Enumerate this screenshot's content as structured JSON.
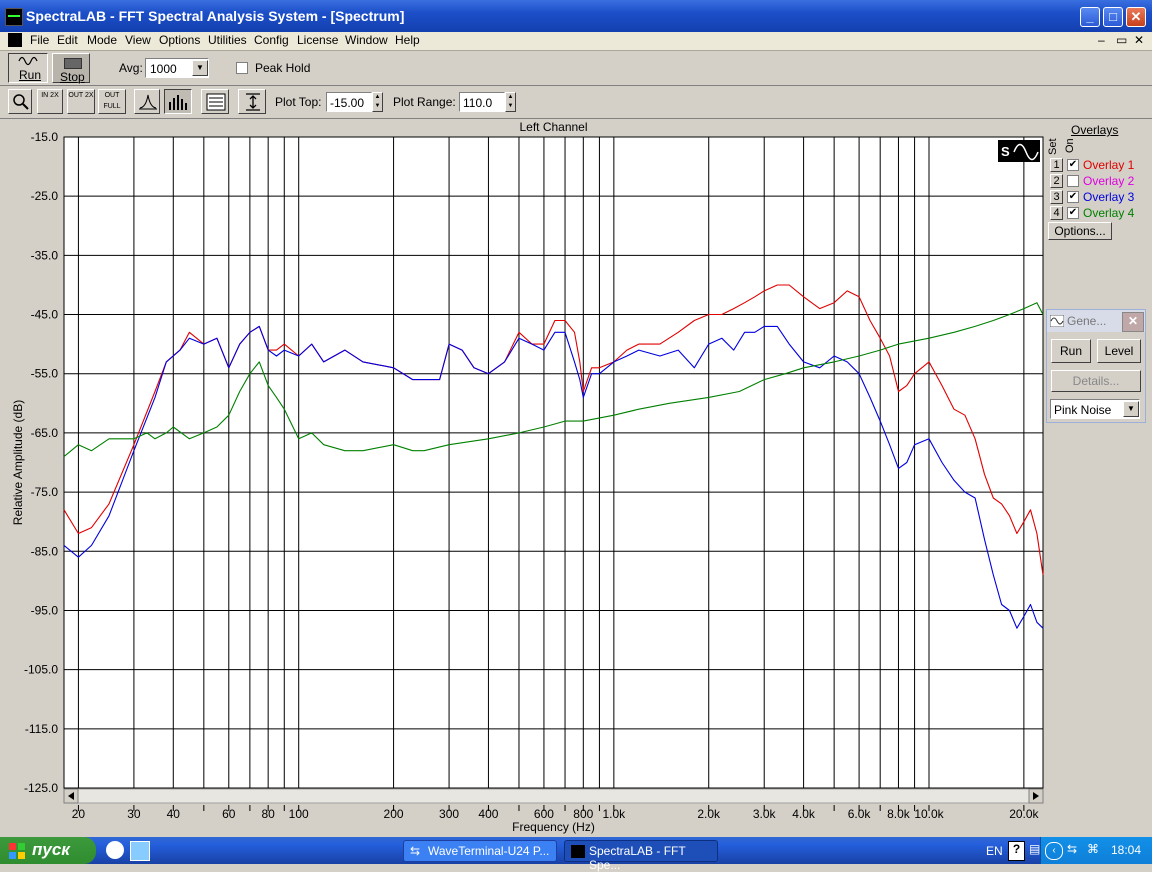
{
  "window": {
    "title": "SpectraLAB - FFT Spectral Analysis System - [Spectrum]"
  },
  "menu": [
    "File",
    "Edit",
    "Mode",
    "View",
    "Options",
    "Utilities",
    "Config",
    "License",
    "Window",
    "Help"
  ],
  "toolbar1": {
    "run_label": "Run",
    "stop_label": "Stop",
    "avg_label": "Avg:",
    "avg_value": "1000",
    "peak_hold_label": "Peak Hold"
  },
  "toolbar2": {
    "plot_top_label": "Plot Top:",
    "plot_top_value": "-15.00",
    "plot_range_label": "Plot Range:",
    "plot_range_value": "110.0",
    "zoom_in_label": "IN 2X",
    "zoom_out_label": "OUT 2X",
    "zoom_full_label": "OUT FULL"
  },
  "overlays": {
    "title": "Overlays",
    "set_label": "Set",
    "on_label": "On",
    "options_label": "Options...",
    "items": [
      {
        "num": "1",
        "label": "Overlay 1",
        "checked": true,
        "color": "#e00000"
      },
      {
        "num": "2",
        "label": "Overlay 2",
        "checked": false,
        "color": "#e000e0"
      },
      {
        "num": "3",
        "label": "Overlay 3",
        "checked": true,
        "color": "#0000e0"
      },
      {
        "num": "4",
        "label": "Overlay 4",
        "checked": true,
        "color": "#008000"
      }
    ]
  },
  "generator": {
    "title": "Gene...",
    "run_label": "Run",
    "level_label": "Level",
    "details_label": "Details...",
    "signal": "Pink Noise"
  },
  "taskbar": {
    "start_label": "пуск",
    "tasks": [
      "WaveTerminal-U24 P...",
      "SpectraLAB - FFT Spe..."
    ],
    "lang": "EN",
    "clock": "18:04"
  },
  "chart_data": {
    "type": "line",
    "title": "Left Channel",
    "xlabel": "Frequency (Hz)",
    "ylabel": "Relative Amplitude (dB)",
    "xscale": "log",
    "xlim": [
      18,
      23000
    ],
    "ylim": [
      -125,
      -15
    ],
    "grid": true,
    "yticks": [
      "-15.0",
      "-25.0",
      "-35.0",
      "-45.0",
      "-55.0",
      "-65.0",
      "-75.0",
      "-85.0",
      "-95.0",
      "-105.0",
      "-115.0",
      "-125.0"
    ],
    "xticks": [
      {
        "v": 20,
        "t": "20"
      },
      {
        "v": 30,
        "t": "30"
      },
      {
        "v": 40,
        "t": "40"
      },
      {
        "v": 60,
        "t": "60"
      },
      {
        "v": 80,
        "t": "80"
      },
      {
        "v": 100,
        "t": "100"
      },
      {
        "v": 200,
        "t": "200"
      },
      {
        "v": 300,
        "t": "300"
      },
      {
        "v": 400,
        "t": "400"
      },
      {
        "v": 600,
        "t": "600"
      },
      {
        "v": 800,
        "t": "800"
      },
      {
        "v": 1000,
        "t": "1.0k"
      },
      {
        "v": 2000,
        "t": "2.0k"
      },
      {
        "v": 3000,
        "t": "3.0k"
      },
      {
        "v": 4000,
        "t": "4.0k"
      },
      {
        "v": 6000,
        "t": "6.0k"
      },
      {
        "v": 8000,
        "t": "8.0k"
      },
      {
        "v": 10000,
        "t": "10.0k"
      },
      {
        "v": 20000,
        "t": "20.0k"
      }
    ],
    "series": [
      {
        "name": "Overlay 1",
        "color": "#e00000",
        "points": [
          [
            18,
            -78
          ],
          [
            20,
            -82
          ],
          [
            22,
            -81
          ],
          [
            25,
            -77
          ],
          [
            30,
            -67
          ],
          [
            35,
            -58
          ],
          [
            38,
            -53
          ],
          [
            42,
            -51
          ],
          [
            45,
            -48
          ],
          [
            50,
            -50
          ],
          [
            55,
            -49
          ],
          [
            60,
            -54
          ],
          [
            65,
            -50
          ],
          [
            70,
            -48
          ],
          [
            75,
            -47
          ],
          [
            80,
            -51
          ],
          [
            85,
            -51
          ],
          [
            90,
            -50
          ],
          [
            100,
            -52
          ],
          [
            110,
            -50
          ],
          [
            120,
            -53
          ],
          [
            140,
            -51
          ],
          [
            160,
            -53
          ],
          [
            200,
            -54
          ],
          [
            230,
            -56
          ],
          [
            250,
            -56
          ],
          [
            280,
            -56
          ],
          [
            300,
            -50
          ],
          [
            330,
            -51
          ],
          [
            360,
            -54
          ],
          [
            400,
            -55
          ],
          [
            450,
            -53
          ],
          [
            500,
            -48
          ],
          [
            550,
            -50
          ],
          [
            600,
            -50
          ],
          [
            650,
            -46
          ],
          [
            700,
            -46
          ],
          [
            750,
            -48
          ],
          [
            780,
            -53
          ],
          [
            800,
            -58
          ],
          [
            850,
            -54
          ],
          [
            900,
            -54
          ],
          [
            1000,
            -53
          ],
          [
            1100,
            -51
          ],
          [
            1200,
            -50
          ],
          [
            1400,
            -50
          ],
          [
            1600,
            -48
          ],
          [
            1800,
            -46
          ],
          [
            2000,
            -45
          ],
          [
            2200,
            -45
          ],
          [
            2400,
            -44
          ],
          [
            2600,
            -43
          ],
          [
            2800,
            -42
          ],
          [
            3000,
            -41
          ],
          [
            3300,
            -40
          ],
          [
            3600,
            -40
          ],
          [
            4000,
            -42
          ],
          [
            4500,
            -44
          ],
          [
            5000,
            -43
          ],
          [
            5500,
            -41
          ],
          [
            6000,
            -42
          ],
          [
            6500,
            -46
          ],
          [
            7000,
            -49
          ],
          [
            7500,
            -52
          ],
          [
            8000,
            -58
          ],
          [
            8500,
            -57
          ],
          [
            9000,
            -55
          ],
          [
            10000,
            -53
          ],
          [
            11000,
            -57
          ],
          [
            12000,
            -61
          ],
          [
            13000,
            -62
          ],
          [
            14000,
            -66
          ],
          [
            15000,
            -72
          ],
          [
            16000,
            -76
          ],
          [
            17000,
            -77
          ],
          [
            18000,
            -79
          ],
          [
            19000,
            -82
          ],
          [
            20000,
            -80
          ],
          [
            21000,
            -78
          ],
          [
            22000,
            -82
          ],
          [
            23000,
            -89
          ]
        ]
      },
      {
        "name": "Overlay 3",
        "color": "#0000e0",
        "points": [
          [
            18,
            -84
          ],
          [
            20,
            -86
          ],
          [
            22,
            -84
          ],
          [
            25,
            -79
          ],
          [
            30,
            -68
          ],
          [
            35,
            -59
          ],
          [
            38,
            -53
          ],
          [
            42,
            -51
          ],
          [
            45,
            -49
          ],
          [
            50,
            -50
          ],
          [
            55,
            -49
          ],
          [
            60,
            -54
          ],
          [
            65,
            -50
          ],
          [
            70,
            -48
          ],
          [
            75,
            -47
          ],
          [
            80,
            -51
          ],
          [
            85,
            -52
          ],
          [
            90,
            -51
          ],
          [
            100,
            -52
          ],
          [
            110,
            -50
          ],
          [
            120,
            -53
          ],
          [
            140,
            -51
          ],
          [
            160,
            -53
          ],
          [
            200,
            -54
          ],
          [
            230,
            -56
          ],
          [
            250,
            -56
          ],
          [
            280,
            -56
          ],
          [
            300,
            -50
          ],
          [
            330,
            -51
          ],
          [
            360,
            -54
          ],
          [
            400,
            -55
          ],
          [
            450,
            -53
          ],
          [
            500,
            -49
          ],
          [
            550,
            -50
          ],
          [
            600,
            -51
          ],
          [
            650,
            -48
          ],
          [
            700,
            -48
          ],
          [
            750,
            -53
          ],
          [
            780,
            -56
          ],
          [
            800,
            -59
          ],
          [
            850,
            -55
          ],
          [
            900,
            -55
          ],
          [
            1000,
            -53
          ],
          [
            1100,
            -52
          ],
          [
            1200,
            -51
          ],
          [
            1400,
            -52
          ],
          [
            1600,
            -51
          ],
          [
            1800,
            -54
          ],
          [
            2000,
            -50
          ],
          [
            2200,
            -49
          ],
          [
            2400,
            -51
          ],
          [
            2600,
            -48
          ],
          [
            2800,
            -48
          ],
          [
            3000,
            -47
          ],
          [
            3300,
            -47
          ],
          [
            3600,
            -50
          ],
          [
            4000,
            -53
          ],
          [
            4500,
            -54
          ],
          [
            5000,
            -52
          ],
          [
            5500,
            -53
          ],
          [
            6000,
            -55
          ],
          [
            6500,
            -59
          ],
          [
            7000,
            -63
          ],
          [
            7500,
            -67
          ],
          [
            8000,
            -71
          ],
          [
            8500,
            -70
          ],
          [
            9000,
            -67
          ],
          [
            10000,
            -66
          ],
          [
            11000,
            -70
          ],
          [
            12000,
            -73
          ],
          [
            13000,
            -75
          ],
          [
            14000,
            -76
          ],
          [
            15000,
            -83
          ],
          [
            16000,
            -89
          ],
          [
            17000,
            -94
          ],
          [
            18000,
            -95
          ],
          [
            19000,
            -98
          ],
          [
            20000,
            -96
          ],
          [
            21000,
            -94
          ],
          [
            22000,
            -97
          ],
          [
            23000,
            -98
          ]
        ]
      },
      {
        "name": "Overlay 4",
        "color": "#008000",
        "points": [
          [
            18,
            -69
          ],
          [
            20,
            -67
          ],
          [
            22,
            -68
          ],
          [
            25,
            -66
          ],
          [
            28,
            -66
          ],
          [
            30,
            -66
          ],
          [
            33,
            -65
          ],
          [
            35,
            -66
          ],
          [
            38,
            -65
          ],
          [
            40,
            -64
          ],
          [
            45,
            -66
          ],
          [
            50,
            -65
          ],
          [
            55,
            -64
          ],
          [
            60,
            -62
          ],
          [
            65,
            -58
          ],
          [
            70,
            -55
          ],
          [
            75,
            -53
          ],
          [
            80,
            -57
          ],
          [
            85,
            -59
          ],
          [
            90,
            -61
          ],
          [
            100,
            -66
          ],
          [
            110,
            -65
          ],
          [
            120,
            -67
          ],
          [
            140,
            -68
          ],
          [
            160,
            -68
          ],
          [
            200,
            -67
          ],
          [
            230,
            -68
          ],
          [
            250,
            -68
          ],
          [
            300,
            -67
          ],
          [
            400,
            -66
          ],
          [
            500,
            -65
          ],
          [
            600,
            -64
          ],
          [
            700,
            -63
          ],
          [
            800,
            -63
          ],
          [
            1000,
            -62
          ],
          [
            1200,
            -61
          ],
          [
            1500,
            -60
          ],
          [
            2000,
            -59
          ],
          [
            2500,
            -58
          ],
          [
            3000,
            -56
          ],
          [
            3500,
            -55
          ],
          [
            4000,
            -54
          ],
          [
            5000,
            -53
          ],
          [
            6000,
            -52
          ],
          [
            7000,
            -51
          ],
          [
            8000,
            -50
          ],
          [
            10000,
            -49
          ],
          [
            12000,
            -48
          ],
          [
            14000,
            -47
          ],
          [
            16000,
            -46
          ],
          [
            18000,
            -45
          ],
          [
            20000,
            -44
          ],
          [
            22000,
            -43
          ],
          [
            23000,
            -45
          ]
        ]
      }
    ]
  }
}
